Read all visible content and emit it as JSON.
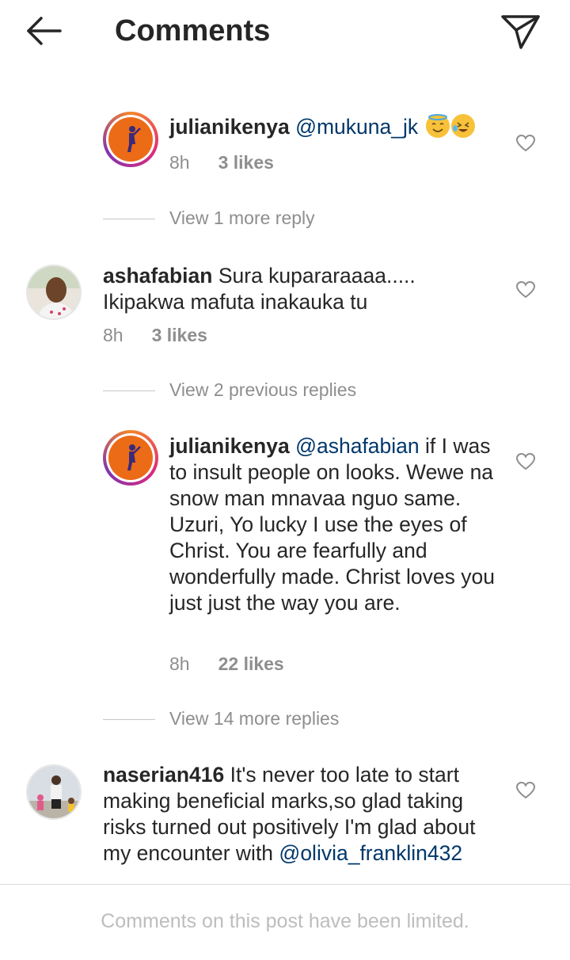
{
  "header": {
    "title": "Comments"
  },
  "comments": [
    {
      "username": "julianikenya",
      "mention": "@mukuna_jk",
      "text": "",
      "time": "8h",
      "likes": "3 likes",
      "emojis": [
        "smiling-face-with-halo",
        "face-with-tears-of-joy"
      ]
    },
    {
      "username": "ashafabian",
      "text": "Sura kupararaaaa.....\nIkipakwa mafuta inakauka tu",
      "time": "8h",
      "likes": "3 likes"
    },
    {
      "username": "julianikenya",
      "mention": "@ashafabian",
      "text": "if I was to insult people on looks. Wewe na snow man mnavaa nguo same.  Uzuri, Yo lucky I use the eyes of Christ. You are fearfully and wonderfully made. Christ loves you just just the way you are.",
      "time": "8h",
      "likes": "22 likes"
    },
    {
      "username": "naserian416",
      "text": "It's never too late to start making beneficial marks,so glad taking risks turned out positively I'm glad about my encounter with",
      "mention": "@olivia_franklin432"
    }
  ],
  "view_replies": [
    {
      "label": "View 1 more reply"
    },
    {
      "label": "View 2 previous replies"
    },
    {
      "label": "View 14 more replies"
    }
  ],
  "footer": {
    "text": "Comments on this post have been limited."
  },
  "colors": {
    "mention": "#00376b",
    "meta": "#8e8e8e",
    "text": "#262626",
    "ring": "#dd2a7b"
  }
}
